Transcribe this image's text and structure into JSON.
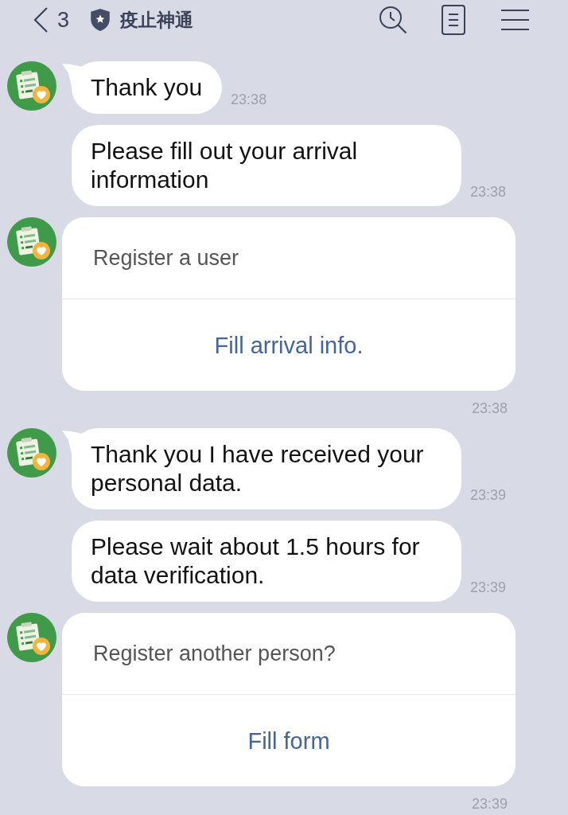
{
  "header": {
    "back_count": "3",
    "title": "疫止神通"
  },
  "messages": [
    {
      "kind": "text",
      "avatar": true,
      "text": "Thank you",
      "time": "23:38"
    },
    {
      "kind": "text",
      "avatar": false,
      "text": "Please fill out your arrival information",
      "time": "23:38"
    },
    {
      "kind": "card",
      "avatar": true,
      "prompt": "Register a user",
      "action": "Fill arrival info.",
      "time": "23:38"
    },
    {
      "kind": "text",
      "avatar": true,
      "text": "Thank you I have received your personal data.",
      "time": "23:39"
    },
    {
      "kind": "text",
      "avatar": false,
      "text": "Please wait about 1.5 hours for data verification.",
      "time": "23:39"
    },
    {
      "kind": "card",
      "avatar": true,
      "prompt": "Register another person?",
      "action": "Fill form",
      "time": "23:39"
    }
  ]
}
